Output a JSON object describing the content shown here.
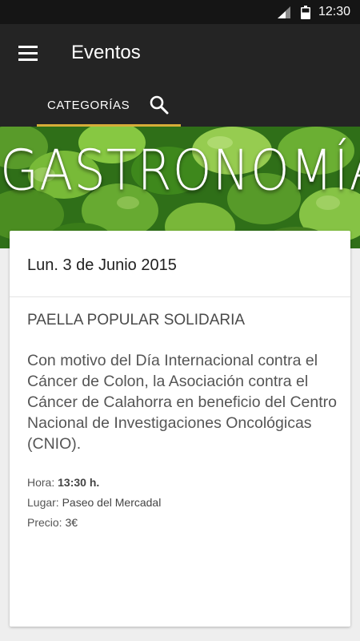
{
  "status_bar": {
    "time": "12:30",
    "icons": [
      "signal-icon",
      "battery-icon"
    ]
  },
  "app_bar": {
    "title": "Eventos",
    "menu_icon": "hamburger-menu-icon",
    "tab_label": "CATEGORÍAS",
    "tab_icon": "search-icon",
    "accent_color": "#d6ad39"
  },
  "banner": {
    "title": "GASTRONOMÍA"
  },
  "event": {
    "date": "Lun. 3 de Junio 2015",
    "name": "PAELLA POPULAR SOLIDARIA",
    "description": "Con motivo del Día Internacional contra el Cáncer de Colon, la Asociación contra el Cáncer de Calahorra en beneficio del Centro Nacional de Investigaciones Oncológicas (CNIO).",
    "hora_label": "Hora:",
    "hora_value": "13:30 h.",
    "lugar_label": "Lugar:",
    "lugar_value": "Paseo del Mercadal",
    "precio_label": "Precio:",
    "precio_value": "3€"
  }
}
